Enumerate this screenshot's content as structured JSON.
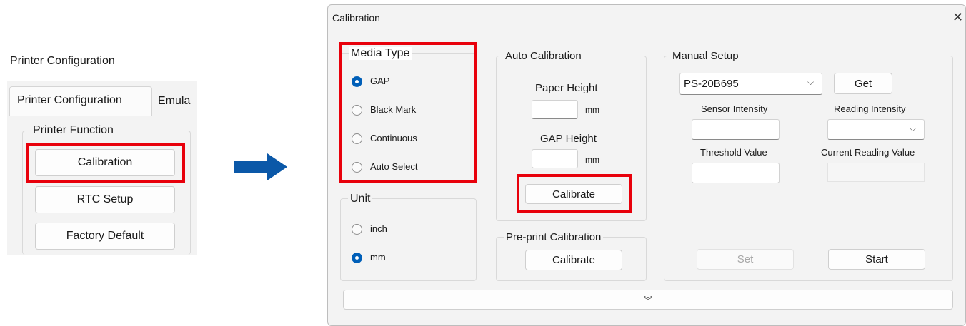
{
  "left_panel": {
    "window_title": "Printer Configuration",
    "tabs": [
      "Printer Configuration",
      "Emula"
    ],
    "group_title": "Printer Function",
    "buttons": [
      "Calibration",
      "RTC Setup",
      "Factory Default"
    ]
  },
  "dialog": {
    "title": "Calibration",
    "close_glyph": "✕",
    "media_type": {
      "title": "Media Type",
      "options": [
        "GAP",
        "Black Mark",
        "Continuous",
        "Auto Select"
      ],
      "selected": "GAP"
    },
    "unit": {
      "title": "Unit",
      "options": [
        "inch",
        "mm"
      ],
      "selected": "mm"
    },
    "auto_calibration": {
      "title": "Auto Calibration",
      "paper_height_label": "Paper Height",
      "paper_height_value": "",
      "paper_unit": "mm",
      "gap_height_label": "GAP Height",
      "gap_height_value": "",
      "gap_unit": "mm",
      "calibrate_label": "Calibrate"
    },
    "preprint_calibration": {
      "title": "Pre-print Calibration",
      "calibrate_label": "Calibrate"
    },
    "manual_setup": {
      "title": "Manual Setup",
      "model_selected": "PS-20B695",
      "get_label": "Get",
      "sensor_intensity_label": "Sensor Intensity",
      "reading_intensity_label": "Reading Intensity",
      "threshold_value_label": "Threshold Value",
      "current_reading_value_label": "Current Reading Value",
      "set_label": "Set",
      "start_label": "Start"
    },
    "expand_glyph": "︾"
  },
  "colors": {
    "highlight": "#e8000b",
    "arrow": "#0b58a8",
    "accent": "#005fb8"
  }
}
